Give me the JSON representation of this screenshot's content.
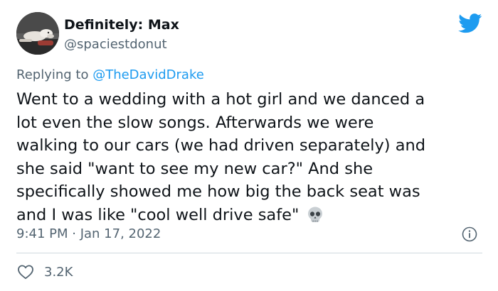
{
  "author": {
    "display_name": "Definitely: Max",
    "handle": "@spaciestdonut"
  },
  "reply": {
    "prefix": "Replying to ",
    "mention": "@TheDavidDrake"
  },
  "tweet": {
    "lines": [
      "Went to a wedding with a hot girl and we danced a",
      "lot even the slow songs. Afterwards we were",
      "walking to our cars (we had driven separately) and",
      "she said \"want to see my new car?\" And she",
      "specifically showed me how big the back seat was",
      "and I was like \"cool well drive safe\""
    ],
    "emoji": "skull-emoji"
  },
  "meta": {
    "timestamp": "9:41 PM · Jan 17, 2022",
    "like_count": "3.2K"
  },
  "icons": {
    "brand": "twitter-bird-icon",
    "info": "info-icon",
    "like": "heart-icon"
  },
  "colors": {
    "brand_blue": "#1d9bf0",
    "text": "#0f1419",
    "secondary_text": "#536471",
    "divider": "#cfd9de"
  }
}
